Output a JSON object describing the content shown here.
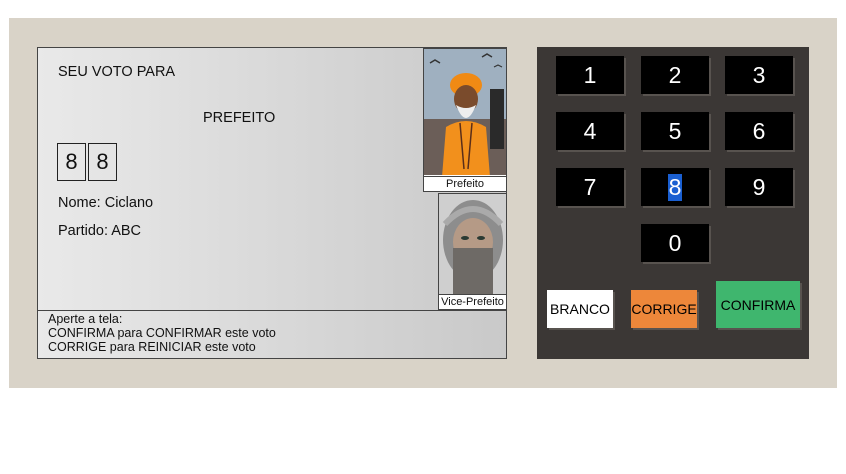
{
  "screen": {
    "heading": "SEU VOTO PARA",
    "office": "PREFEITO",
    "digits": [
      "8",
      "8"
    ],
    "name_line": "Nome: Ciclano",
    "party_line": "Partido: ABC",
    "photos": {
      "main_caption": "Prefeito",
      "vice_caption": "Vice-Prefeito"
    },
    "footer": {
      "line1": "Aperte a tela:",
      "line2": "CONFIRMA para CONFIRMAR este voto",
      "line3": "CORRIGE para REINICIAR este voto"
    }
  },
  "keypad": {
    "keys": [
      "1",
      "2",
      "3",
      "4",
      "5",
      "6",
      "7",
      "8",
      "9",
      "0"
    ],
    "selected_key": "8",
    "branco_label": "BRANCO",
    "corrige_label": "CORRIGE",
    "confirma_label": "CONFIRMA",
    "colors": {
      "panel": "#3b3735",
      "key": "#000000",
      "branco": "#ffffff",
      "corrige": "#ed873a",
      "confirma": "#3fb66e"
    }
  }
}
